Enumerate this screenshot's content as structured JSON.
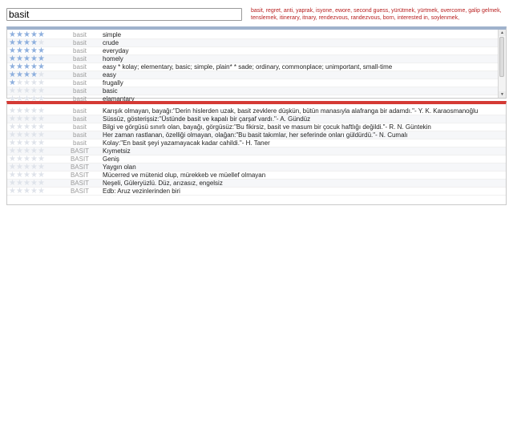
{
  "search": {
    "value": "basit"
  },
  "history": [
    "basit",
    "regret",
    "anti",
    "yaprak",
    "isyone",
    "ewore",
    "second guess",
    "yürütmek",
    "yürtmek",
    "overcome",
    "galip gelmek",
    "tenslemek",
    "itinerary",
    "itnary",
    "rendezvous",
    "randezvous",
    "born",
    "interested in",
    "soylenmek"
  ],
  "en_rows": [
    {
      "stars": 5,
      "pos": "basit",
      "term": "simple"
    },
    {
      "stars": 4,
      "pos": "basit",
      "term": "crude"
    },
    {
      "stars": 5,
      "pos": "basit",
      "term": "everyday"
    },
    {
      "stars": 5,
      "pos": "basit",
      "term": "homely"
    },
    {
      "stars": 5,
      "pos": "basit",
      "term": "easy * kolay; elementary, basic; simple, plain* * sade; ordinary, commonplace; unimportant, small-time"
    },
    {
      "stars": 4,
      "pos": "basit",
      "term": "easy"
    },
    {
      "stars": 1,
      "pos": "basit",
      "term": "frugally"
    },
    {
      "stars": 0,
      "pos": "basit",
      "term": "basic"
    },
    {
      "stars": 0,
      "pos": "basit",
      "term": "elamantary"
    }
  ],
  "tr_rows": [
    {
      "stars": 0,
      "pos": "basit",
      "term": "Karışık olmayan, bayağı:\"Derin hislerden uzak, basit zevklere düşkün, bütün manasıyla alafranga bir adamdı.\"- Y. K. Karaosmanoğlu"
    },
    {
      "stars": 0,
      "pos": "basit",
      "term": "Süssüz, gösterişsiz:\"Üstünde basit ve kapalı bir çarşaf vardı.\"- A. Gündüz"
    },
    {
      "stars": 0,
      "pos": "basit",
      "term": "Bilgi ve görgüsü sınırlı olan, bayağı, görgüsüz:\"Bu fikirsiz, basit ve masum bir çocuk haftlığı değildi.\"- R. N. Güntekin"
    },
    {
      "stars": 0,
      "pos": "basit",
      "term": "Her zaman rastlanan, özelliği olmayan, olağan:\"Bu basit takımlar, her seferinde onları güldürdü.\"- N. Cumalı"
    },
    {
      "stars": 0,
      "pos": "basit",
      "term": "Kolay:\"En basit şeyi yazamayacak kadar cahildi.\"- H. Taner"
    },
    {
      "stars": 0,
      "pos": "BASIT",
      "term": "Kıymetsiz"
    },
    {
      "stars": 0,
      "pos": "BASIT",
      "term": "Geniş"
    },
    {
      "stars": 0,
      "pos": "BASIT",
      "term": "Yaygın olan"
    },
    {
      "stars": 0,
      "pos": "BASIT",
      "term": "Mücerred ve mütenid olup, mürekkeb ve müellef olmayan"
    },
    {
      "stars": 0,
      "pos": "BASIT",
      "term": "Neşeli, Güleryüzlü. Düz, arızasız, engelsiz"
    },
    {
      "stars": 0,
      "pos": "BASIT",
      "term": "Edb: Aruz vezinlerinden biri"
    }
  ]
}
